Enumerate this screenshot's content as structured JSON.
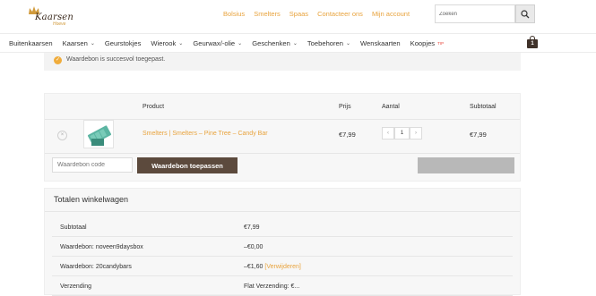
{
  "brand": {
    "name": "Kaarsen",
    "sub": "Hoeve"
  },
  "topnav": [
    "Bolsius",
    "Smelters",
    "Spaas",
    "Contacteer ons",
    "Mijn account"
  ],
  "search": {
    "placeholder": "Zoeken"
  },
  "mainnav": [
    {
      "label": "Buitenkaarsen",
      "caret": false
    },
    {
      "label": "Kaarsen",
      "caret": true
    },
    {
      "label": "Geurstokjes",
      "caret": false
    },
    {
      "label": "Wierook",
      "caret": true
    },
    {
      "label": "Geurwax/-olie",
      "caret": true
    },
    {
      "label": "Geschenken",
      "caret": true
    },
    {
      "label": "Toebehoren",
      "caret": true
    },
    {
      "label": "Wenskaarten",
      "caret": false
    },
    {
      "label": "Koopjes",
      "caret": false,
      "badge": "TIP"
    }
  ],
  "cart_count": "1",
  "notice": "Waardebon is succesvol toegepast.",
  "table": {
    "headers": {
      "product": "Product",
      "price": "Prijs",
      "qty": "Aantal",
      "subtotal": "Subtotaal"
    },
    "row": {
      "name": "Smelters | Smelters – Pine Tree – Candy Bar",
      "price": "€7,99",
      "qty": "1",
      "subtotal": "€7,99"
    },
    "coupon_placeholder": "Waardebon code",
    "coupon_button": "Waardebon toepassen"
  },
  "totals": {
    "title": "Totalen winkelwagen",
    "rows": [
      {
        "label": "Subtotaal",
        "value": "€7,99"
      },
      {
        "label": "Waardebon: noveen9daysbox",
        "value": "–€0,00"
      },
      {
        "label": "Waardebon: 20candybars",
        "value": "–€1,60",
        "link": "[Verwijderen]"
      },
      {
        "label": "Verzending",
        "value": "Flat Verzending: €..."
      }
    ]
  },
  "colors": {
    "accent": "#e8a33d",
    "dark_button": "#5c4a3d"
  }
}
